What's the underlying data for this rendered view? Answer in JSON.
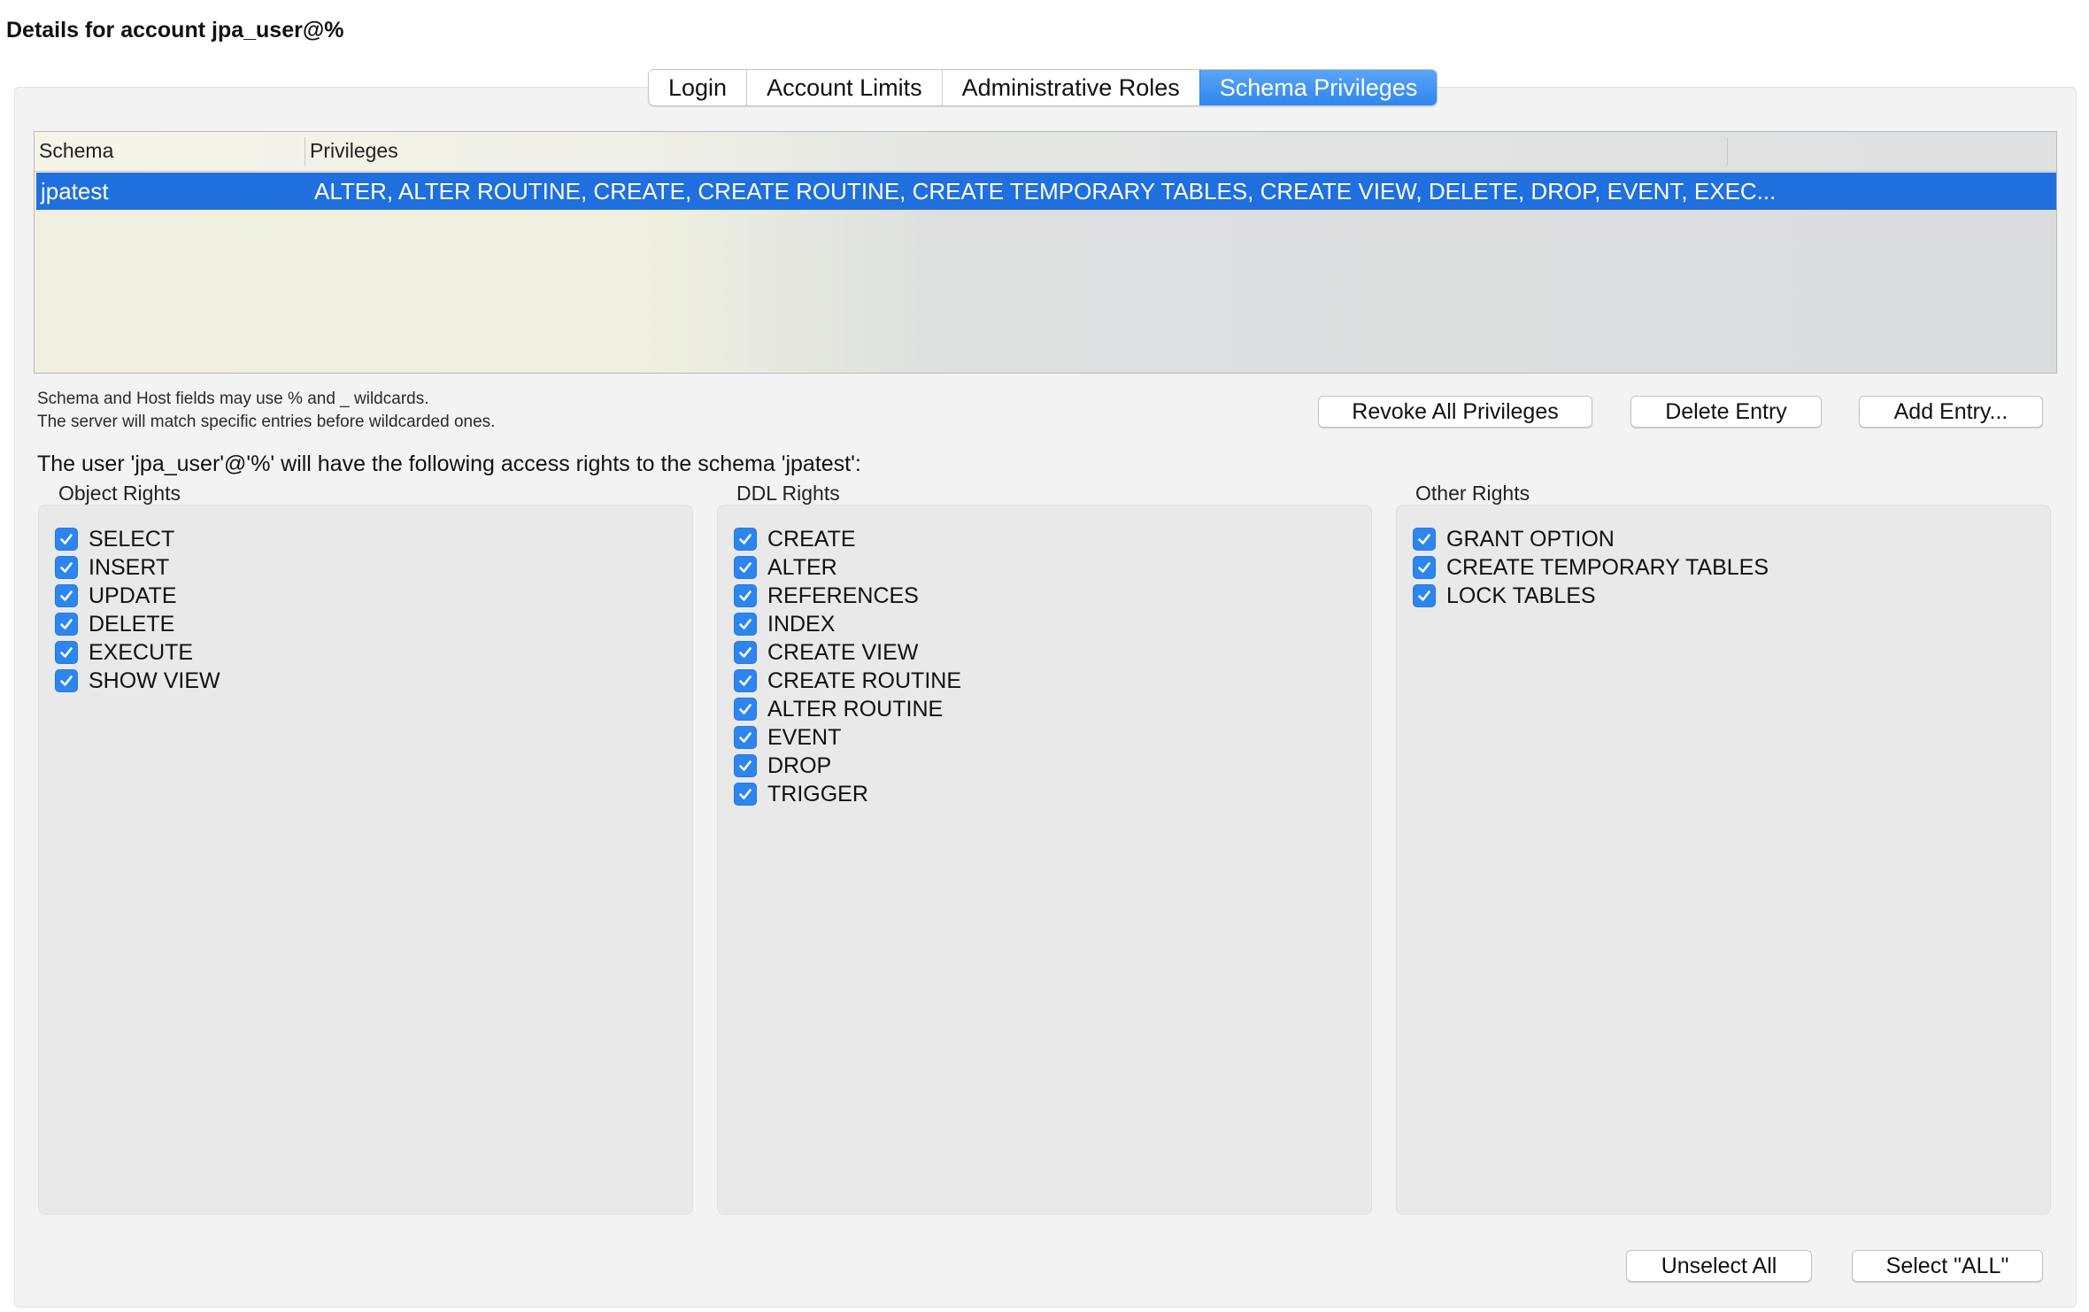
{
  "window": {
    "title": "Details for account jpa_user@%"
  },
  "tabs": [
    {
      "label": "Login",
      "active": false
    },
    {
      "label": "Account Limits",
      "active": false
    },
    {
      "label": "Administrative Roles",
      "active": false
    },
    {
      "label": "Schema Privileges",
      "active": true
    }
  ],
  "table": {
    "columns": [
      "Schema",
      "Privileges"
    ],
    "rows": [
      {
        "schema": "jpatest",
        "privileges": "ALTER, ALTER ROUTINE, CREATE, CREATE ROUTINE, CREATE TEMPORARY TABLES, CREATE VIEW, DELETE, DROP, EVENT, EXEC...",
        "selected": true
      }
    ]
  },
  "hints": {
    "line1": "Schema and Host fields may use % and _ wildcards.",
    "line2": "The server will match specific entries before wildcarded ones."
  },
  "actions": {
    "revoke": "Revoke All Privileges",
    "delete": "Delete Entry",
    "add": "Add Entry..."
  },
  "access_label": "The user 'jpa_user'@'%' will have the following access rights to the schema 'jpatest':",
  "groups": {
    "object": {
      "title": "Object Rights",
      "items": [
        {
          "label": "SELECT",
          "checked": true
        },
        {
          "label": "INSERT",
          "checked": true
        },
        {
          "label": "UPDATE",
          "checked": true
        },
        {
          "label": "DELETE",
          "checked": true
        },
        {
          "label": "EXECUTE",
          "checked": true
        },
        {
          "label": "SHOW VIEW",
          "checked": true
        }
      ]
    },
    "ddl": {
      "title": "DDL Rights",
      "items": [
        {
          "label": "CREATE",
          "checked": true
        },
        {
          "label": "ALTER",
          "checked": true
        },
        {
          "label": "REFERENCES",
          "checked": true
        },
        {
          "label": "INDEX",
          "checked": true
        },
        {
          "label": "CREATE VIEW",
          "checked": true
        },
        {
          "label": "CREATE ROUTINE",
          "checked": true
        },
        {
          "label": "ALTER ROUTINE",
          "checked": true
        },
        {
          "label": "EVENT",
          "checked": true
        },
        {
          "label": "DROP",
          "checked": true
        },
        {
          "label": "TRIGGER",
          "checked": true
        }
      ]
    },
    "other": {
      "title": "Other Rights",
      "items": [
        {
          "label": "GRANT OPTION",
          "checked": true
        },
        {
          "label": "CREATE TEMPORARY TABLES",
          "checked": true
        },
        {
          "label": "LOCK TABLES",
          "checked": true
        }
      ]
    }
  },
  "footer": {
    "unselect_all": "Unselect All",
    "select_all": "Select \"ALL\""
  },
  "colors": {
    "accent": "#2d86ee",
    "selection": "#1f6fde"
  },
  "icons": {
    "checkbox": "checkmark-icon"
  }
}
